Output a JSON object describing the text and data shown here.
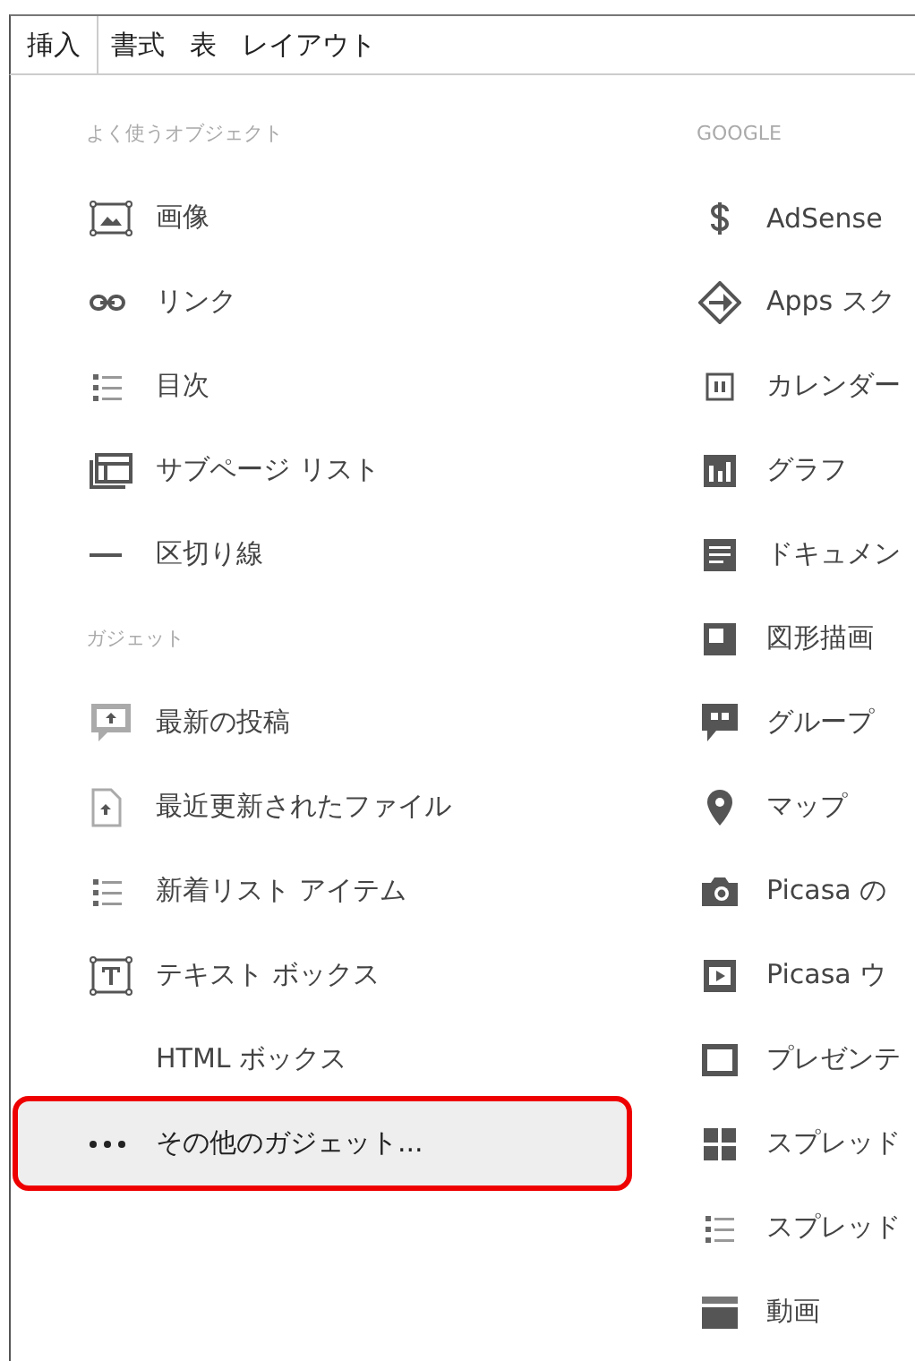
{
  "menu_tabs": [
    {
      "label": "挿入",
      "selected": true
    },
    {
      "label": "書式",
      "selected": false
    },
    {
      "label": "表",
      "selected": false
    },
    {
      "label": "レイアウト",
      "selected": false
    }
  ],
  "left_sections": [
    {
      "heading": "よく使うオブジェクト",
      "items": [
        {
          "label": "画像",
          "hovered": false
        },
        {
          "label": "リンク",
          "hovered": false
        },
        {
          "label": "目次",
          "hovered": false
        },
        {
          "label": "サブページ リスト",
          "hovered": false
        },
        {
          "label": "区切り線",
          "hovered": false
        }
      ]
    },
    {
      "heading": "ガジェット",
      "items": [
        {
          "label": "最新の投稿",
          "hovered": false
        },
        {
          "label": "最近更新されたファイル",
          "hovered": false
        },
        {
          "label": "新着リスト アイテム",
          "hovered": false
        },
        {
          "label": "テキスト ボックス",
          "hovered": false
        },
        {
          "label": "HTML ボックス",
          "hovered": false
        },
        {
          "label": "その他のガジェット...",
          "hovered": true
        }
      ]
    }
  ],
  "google": {
    "heading": "GOOGLE",
    "items": [
      {
        "label": "AdSense"
      },
      {
        "label": "Apps スク"
      },
      {
        "label": "カレンダー"
      },
      {
        "label": "グラフ"
      },
      {
        "label": "ドキュメン"
      },
      {
        "label": "図形描画"
      },
      {
        "label": "グループ"
      },
      {
        "label": "マップ"
      },
      {
        "label": "Picasa の"
      },
      {
        "label": "Picasa ウ"
      },
      {
        "label": "プレゼンテ"
      },
      {
        "label": "スプレッド"
      },
      {
        "label": "スプレッド"
      },
      {
        "label": "動画"
      }
    ]
  }
}
